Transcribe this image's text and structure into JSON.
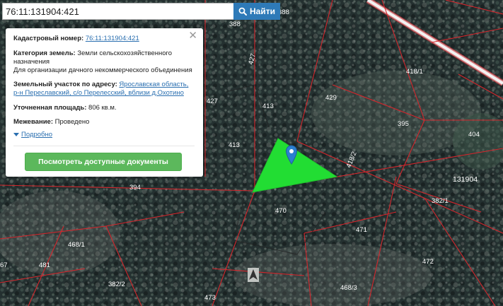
{
  "search": {
    "value": "76:11:131904:421",
    "button_label": "Найти",
    "button_icon": "search-icon"
  },
  "info": {
    "cadastral_label": "Кадастровый номер:",
    "cadastral_value": "76:11:131904:421",
    "category_label": "Категория земель:",
    "category_value_1": "Земли сельскохозяйственного",
    "category_value_2": "назначения",
    "category_use": "Для организации дачного некоммерческого объединения",
    "address_label": "Земельный участок по адресу:",
    "address_value_1": "Ярославская область,",
    "address_value_2": "р-н Переславский, с/о Перелесский, вблизи д.Охотино",
    "area_label": "Уточненная площадь:",
    "area_value": "806 кв.м.",
    "survey_label": "Межевание:",
    "survey_value": "Проведено",
    "more_label": "Подробно",
    "docs_button": "Посмотреть доступные документы",
    "close_symbol": "✕"
  },
  "map": {
    "labels": {
      "p388a": "388",
      "p388b": "388",
      "p427a": "427",
      "p427b": "427",
      "p413a": "413",
      "p413b": "413",
      "p429": "429",
      "p395": "395",
      "p404": "404",
      "p418_1": "418/1",
      "p418_2": "418/2",
      "p131904": "131904",
      "p394": "394",
      "p382_1": "382/1",
      "p382_2": "382/2",
      "p470": "470",
      "p471": "471",
      "p468_1": "468/1",
      "p468_3": "468/3",
      "p481": "481",
      "p472": "472",
      "p473": "473",
      "p67": "67"
    },
    "highlight_color": "#22dd33",
    "boundary_color": "#d4262c",
    "marker_color": "#2b7fd0"
  }
}
